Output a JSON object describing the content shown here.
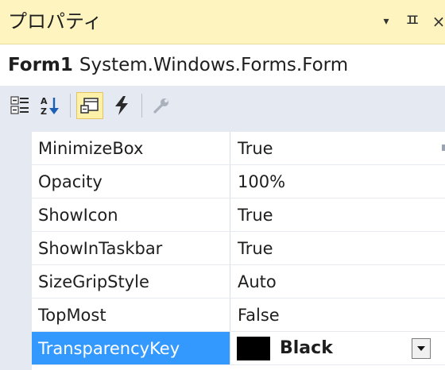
{
  "panel": {
    "title": "プロパティ",
    "dropdown_glyph": "▾",
    "pin_glyph": "ㅍ",
    "close_glyph": "×"
  },
  "object": {
    "name": "Form1",
    "type": "System.Windows.Forms.Form"
  },
  "toolbar": {
    "tools": [
      {
        "icon": "categorized-icon",
        "active": false
      },
      {
        "icon": "alphabetical-icon",
        "active": false
      },
      {
        "icon": "properties-icon",
        "active": true
      },
      {
        "icon": "events-icon",
        "active": false
      },
      {
        "icon": "property-pages-icon",
        "active": false
      }
    ]
  },
  "properties": {
    "rows": [
      {
        "name": "MinimizeBox",
        "value": "True"
      },
      {
        "name": "Opacity",
        "value": "100%"
      },
      {
        "name": "ShowIcon",
        "value": "True"
      },
      {
        "name": "ShowInTaskbar",
        "value": "True"
      },
      {
        "name": "SizeGripStyle",
        "value": "Auto"
      },
      {
        "name": "TopMost",
        "value": "False"
      }
    ],
    "selected": {
      "name": "TransparencyKey",
      "value": "Black",
      "swatch_color": "#000000"
    }
  },
  "colors": {
    "title_bg": "#fdf4bf",
    "selection": "#3399ff",
    "toolbar_bg": "#e4e9f2"
  }
}
